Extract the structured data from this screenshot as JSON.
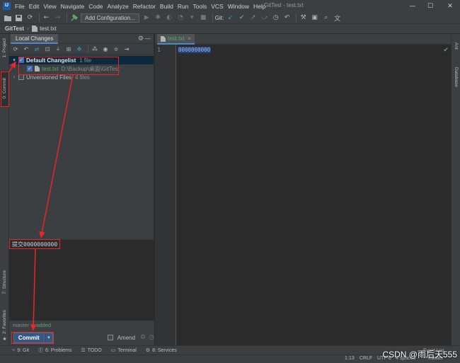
{
  "app": {
    "window_title": "GitTest - test.txt",
    "menu": [
      "File",
      "Edit",
      "View",
      "Navigate",
      "Code",
      "Analyze",
      "Refactor",
      "Build",
      "Run",
      "Tools",
      "VCS",
      "Window",
      "Help"
    ]
  },
  "toolbar": {
    "run_config_label": "Add Configuration...",
    "git_label": "Git:"
  },
  "breadcrumb": {
    "project": "GitTest",
    "file": "test.txt"
  },
  "left_strip": {
    "project": "1: Project",
    "commit": "0: Commit",
    "structure": "7: Structure",
    "favorites": "2: Favorites"
  },
  "right_strip": {
    "ant": "Ant",
    "database": "Database"
  },
  "commit_panel": {
    "tab_label": "Local Changes",
    "changelist": {
      "name": "Default Changelist",
      "count": "1 file"
    },
    "file": {
      "name": "test.txt",
      "path": "D:\\Backup\\桌面\\GitTest"
    },
    "unversioned": {
      "label": "Unversioned Files",
      "count": "4 files"
    },
    "message": "提交0000000000",
    "branch": "master",
    "summary": "1 added",
    "commit_label": "Commit",
    "amend_label": "Amend"
  },
  "editor": {
    "tab_label": "test.txt",
    "line_number": "1",
    "line_text": "0000000000"
  },
  "bottom_tools": [
    {
      "key": "9",
      "label": "Git"
    },
    {
      "key": "6",
      "label": "Problems"
    },
    {
      "key": "",
      "label": "TODO"
    },
    {
      "key": "",
      "label": "Terminal"
    },
    {
      "key": "8",
      "label": "Services"
    }
  ],
  "status_bar": {
    "position": "1:13",
    "line_sep": "CRLF",
    "encoding": "UTF-8",
    "indent": "4 spaces",
    "branch": "master",
    "event_log": "Event Log"
  },
  "watermark": "CSDN @雨后天555",
  "colors": {
    "accent": "#4a88c7",
    "annotation": "#e8262b",
    "commit_button": "#365880"
  }
}
